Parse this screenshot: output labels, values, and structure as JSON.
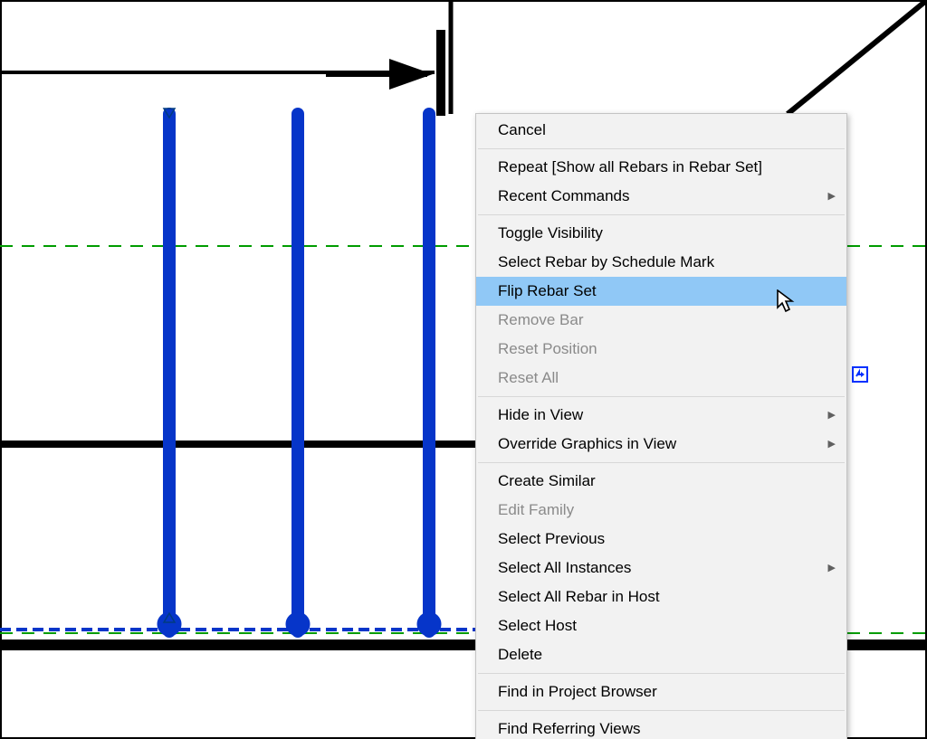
{
  "menu": {
    "cancel": "Cancel",
    "repeat": "Repeat [Show all Rebars in Rebar Set]",
    "recent": "Recent Commands",
    "toggle_visibility": "Toggle Visibility",
    "select_by_schedule_mark": "Select Rebar by Schedule Mark",
    "flip_rebar_set": "Flip Rebar Set",
    "remove_bar": "Remove Bar",
    "reset_position": "Reset Position",
    "reset_all": "Reset All",
    "hide_in_view": "Hide in View",
    "override_graphics": "Override Graphics in View",
    "create_similar": "Create Similar",
    "edit_family": "Edit Family",
    "select_previous": "Select Previous",
    "select_all_instances": "Select All Instances",
    "select_all_rebar_in_host": "Select All Rebar in Host",
    "select_host": "Select Host",
    "delete": "Delete",
    "find_in_browser": "Find in Project Browser",
    "find_referring_views": "Find Referring Views"
  }
}
